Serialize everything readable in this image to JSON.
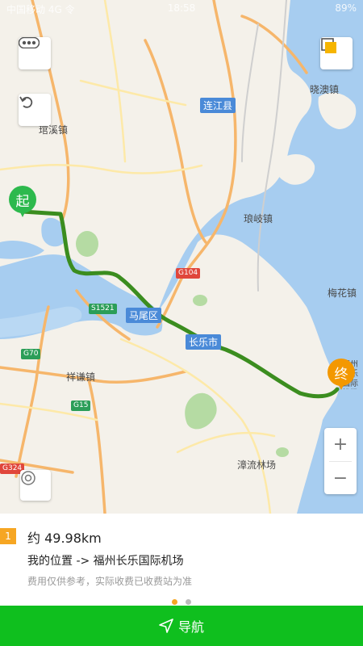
{
  "status_bar": {
    "left": "中国移动 4G 令",
    "time": "18:58",
    "right": "89%"
  },
  "map": {
    "places": [
      {
        "name": "晓澳镇",
        "style": "normal"
      },
      {
        "name": "连江县",
        "style": "major"
      },
      {
        "name": "琯溪镇",
        "style": "normal"
      },
      {
        "name": "琅岐镇",
        "style": "normal"
      },
      {
        "name": "梅花镇",
        "style": "normal"
      },
      {
        "name": "马尾区",
        "style": "major"
      },
      {
        "name": "长乐市",
        "style": "major"
      },
      {
        "name": "祥谦镇",
        "style": "normal"
      },
      {
        "name": "漳流林场",
        "style": "normal"
      },
      {
        "name": "福州长乐国际机场",
        "style": "airport"
      }
    ],
    "road_shields": [
      {
        "label": "G104",
        "color": "#e0463b"
      },
      {
        "label": "S1521",
        "color": "#2b9e58"
      },
      {
        "label": "G70",
        "color": "#2b9e58"
      },
      {
        "label": "G15",
        "color": "#2b9e58"
      },
      {
        "label": "G324",
        "color": "#e0463b"
      }
    ],
    "start_marker": {
      "label": "起",
      "color": "#2db94d"
    },
    "end_marker": {
      "label": "终",
      "color": "#f39800"
    },
    "route_color": "#3b8d1f",
    "zoom_in": "+",
    "zoom_out": "−"
  },
  "panel": {
    "route_index": "1",
    "distance": "约 49.98km",
    "route_text": "我的位置 -> 福州长乐国际机场",
    "toll_note": "费用仅供参考，实际收费已收费站为准",
    "page_dots": {
      "count": 2,
      "active": 0,
      "active_color": "#f6a623",
      "inactive_color": "#bbbbbb"
    }
  },
  "nav_button": {
    "label": "导航",
    "color": "#0fbf1e"
  }
}
